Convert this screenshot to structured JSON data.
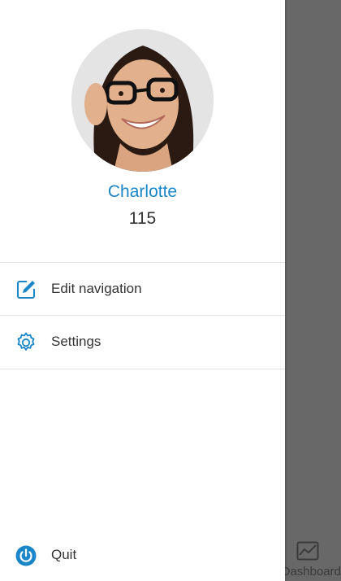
{
  "profile": {
    "name": "Charlotte",
    "points": "115"
  },
  "menu": {
    "items": [
      {
        "label": "Edit navigation",
        "icon": "edit-icon"
      },
      {
        "label": "Settings",
        "icon": "gear-icon"
      }
    ],
    "quit_label": "Quit",
    "quit_icon": "power-icon"
  },
  "background_app": {
    "tab_label": "Dashboard",
    "tab_icon": "chart-icon"
  },
  "colors": {
    "accent": "#1a86c7",
    "text": "#333333",
    "overlay": "#686868"
  }
}
